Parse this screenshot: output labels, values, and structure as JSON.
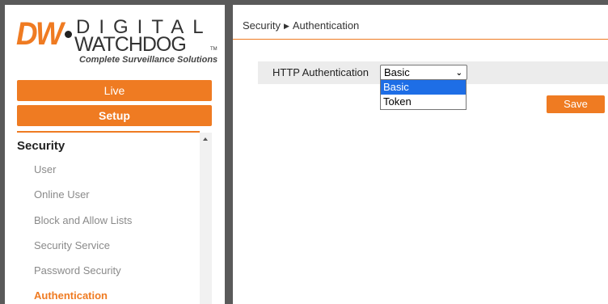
{
  "logo": {
    "brand_short": "DW",
    "brand_top": "DIGITAL",
    "brand_bottom": "WATCHDOG",
    "tagline": "Complete Surveillance Solutions"
  },
  "nav": {
    "live_label": "Live",
    "setup_label": "Setup"
  },
  "menu": {
    "title": "Security",
    "items": [
      {
        "label": "User",
        "active": false
      },
      {
        "label": "Online User",
        "active": false
      },
      {
        "label": "Block and Allow Lists",
        "active": false
      },
      {
        "label": "Security Service",
        "active": false
      },
      {
        "label": "Password Security",
        "active": false
      },
      {
        "label": "Authentication",
        "active": true
      }
    ]
  },
  "breadcrumb": {
    "section": "Security",
    "separator": "▶",
    "page": "Authentication"
  },
  "form": {
    "http_auth_label": "HTTP Authentication",
    "http_auth_value": "Basic",
    "options": [
      "Basic",
      "Token"
    ],
    "highlighted_option": "Basic"
  },
  "save_label": "Save",
  "colors": {
    "accent": "#ef7b22",
    "selection": "#1e6ee6",
    "frame": "#5a5a5a"
  }
}
